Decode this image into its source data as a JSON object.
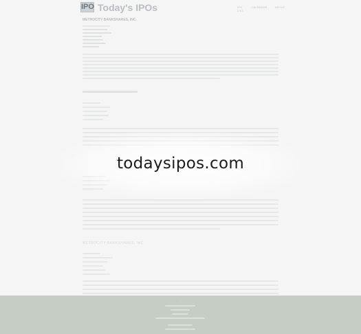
{
  "header": {
    "logo_text": "IPO",
    "site_title": "Today's IPOs",
    "nav": [
      "IPO LIST",
      "CALENDAR",
      "ABOUT"
    ]
  },
  "article": {
    "company_name": "METROCITY BANKSHARES, INC.",
    "section_titles": [
      "METROCITY BANKSHARES, INC."
    ]
  },
  "watermark": "todaysipos.com",
  "colors": {
    "background": "#f4f5f4",
    "footer": "#c6cdc4",
    "header_title": "#b9bec2",
    "watermark": "#1b1b1b"
  }
}
